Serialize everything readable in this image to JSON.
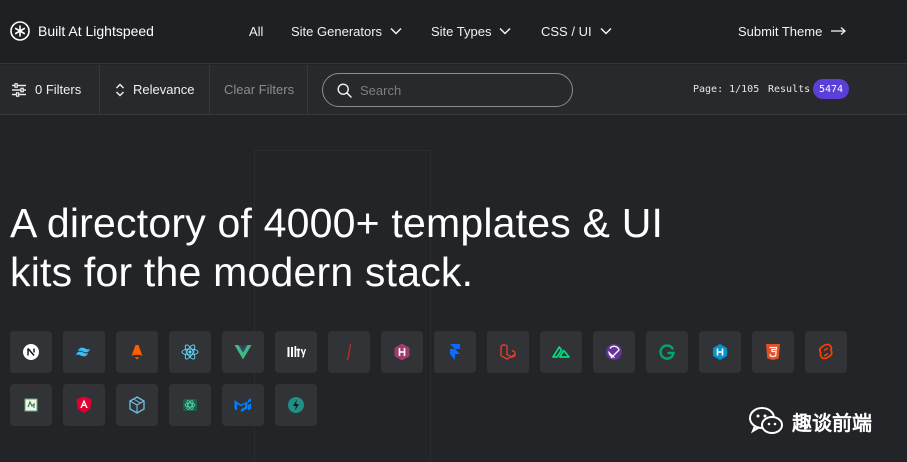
{
  "brand": {
    "name": "Built At Lightspeed",
    "icon": "asterisk-logo-icon"
  },
  "nav": {
    "items": [
      {
        "label": "All",
        "has_dropdown": false
      },
      {
        "label": "Site Generators",
        "has_dropdown": true
      },
      {
        "label": "Site Types",
        "has_dropdown": true
      },
      {
        "label": "CSS / UI",
        "has_dropdown": true
      }
    ],
    "submit_theme": "Submit Theme"
  },
  "filterbar": {
    "filters_label": "0 Filters",
    "sort_label": "Relevance",
    "clear_label": "Clear Filters",
    "search_placeholder": "Search",
    "search_value": "",
    "page_label": "Page: 1/105",
    "results_label": "Results",
    "results_count": "5474"
  },
  "hero": {
    "title_line1": "A directory of 4000+ templates & UI",
    "title_line2": "kits for the modern stack."
  },
  "frameworks": [
    "nextjs-icon",
    "tailwind-icon",
    "astro-icon",
    "react-icon",
    "vue-icon",
    "eleventy-icon",
    "jekyll-icon",
    "hexo-icon",
    "framer-icon",
    "laravel-icon",
    "nuxt-icon",
    "gatsby-icon",
    "gridsome-icon",
    "hugo-icon",
    "html5-icon",
    "svelte-icon",
    "middleman-icon",
    "angular-icon",
    "vuepress-icon",
    "react-native-icon",
    "mui-icon",
    "remix-icon"
  ],
  "watermark": {
    "text": "趣谈前端",
    "icon": "wechat-icon"
  },
  "colors": {
    "background": "#232427",
    "nav_background": "#1f2023",
    "filterbar_background": "#28292c",
    "badge_purple": "#5b3fd8",
    "tile_background": "#323337"
  }
}
